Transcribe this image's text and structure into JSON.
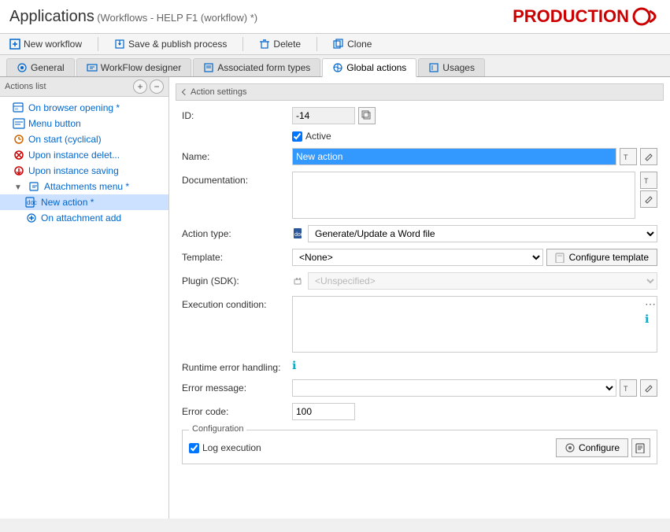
{
  "header": {
    "app_title": "Applications",
    "subtitle": "(Workflows - HELP F1 (workflow) *)",
    "production_label": "PRODUCTION"
  },
  "toolbar": {
    "new_workflow": "New workflow",
    "save_publish": "Save & publish process",
    "delete": "Delete",
    "clone": "Clone"
  },
  "tabs": [
    {
      "id": "general",
      "label": "General",
      "active": false
    },
    {
      "id": "workflow-designer",
      "label": "WorkFlow designer",
      "active": false
    },
    {
      "id": "form-types",
      "label": "Associated form types",
      "active": false
    },
    {
      "id": "global-actions",
      "label": "Global actions",
      "active": true
    },
    {
      "id": "usages",
      "label": "Usages",
      "active": false
    }
  ],
  "actions_panel": {
    "title": "Actions list",
    "items": [
      {
        "id": "on-browser-opening",
        "label": "On browser opening *",
        "level": 0,
        "icon": "doc-icon"
      },
      {
        "id": "menu-button",
        "label": "Menu button",
        "level": 0,
        "icon": "menu-icon"
      },
      {
        "id": "on-start",
        "label": "On start (cyclical)",
        "level": 0,
        "icon": "cycle-icon"
      },
      {
        "id": "upon-instance-delet",
        "label": "Upon instance delet...",
        "level": 0,
        "icon": "delete-icon"
      },
      {
        "id": "upon-instance-saving",
        "label": "Upon instance saving",
        "level": 0,
        "icon": "save-icon"
      },
      {
        "id": "attachments-menu",
        "label": "Attachments menu *",
        "level": 0,
        "icon": "attach-icon",
        "expanded": true
      },
      {
        "id": "new-action",
        "label": "New action *",
        "level": 1,
        "icon": "action-icon",
        "selected": true
      },
      {
        "id": "on-attachment-add",
        "label": "On attachment add",
        "level": 1,
        "icon": "add-icon"
      }
    ]
  },
  "action_settings": {
    "title": "Action settings",
    "id_value": "-14",
    "active_checked": true,
    "active_label": "Active",
    "name_label": "Name:",
    "name_value": "New action",
    "documentation_label": "Documentation:",
    "documentation_value": "",
    "action_type_label": "Action type:",
    "action_type_value": "Generate/Update a Word file",
    "template_label": "Template:",
    "template_value": "<None>",
    "configure_template_label": "Configure template",
    "plugin_label": "Plugin (SDK):",
    "plugin_value": "<Unspecified>",
    "execution_condition_label": "Execution condition:",
    "runtime_error_label": "Runtime error handling:",
    "error_message_label": "Error message:",
    "error_code_label": "Error code:",
    "error_code_value": "100",
    "configuration_title": "Configuration",
    "log_execution_label": "Log execution",
    "log_execution_checked": true,
    "configure_label": "Configure"
  }
}
